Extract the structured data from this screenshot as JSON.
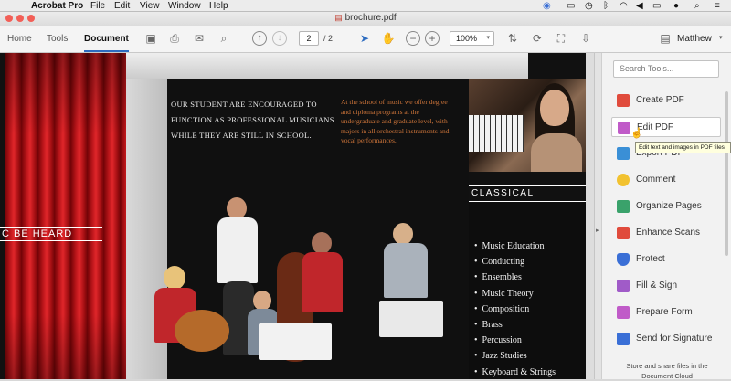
{
  "menubar": {
    "apple": "",
    "app": "Acrobat Pro",
    "items": [
      "File",
      "Edit",
      "View",
      "Window",
      "Help"
    ]
  },
  "window": {
    "title": "brochure.pdf"
  },
  "toolbar": {
    "tabs": [
      {
        "label": "Home",
        "active": false
      },
      {
        "label": "Tools",
        "active": false
      },
      {
        "label": "Document",
        "active": true
      }
    ],
    "page_current": "2",
    "page_total": "/ 2",
    "zoom": "100%",
    "user": "Matthew"
  },
  "document": {
    "side_heading": "C BE HEARD",
    "intro_text": "OUR STUDENT ARE ENCOURAGED TO FUNCTION AS PROFESSIONAL MUSICIANS WHILE THEY ARE STILL IN SCHOOL.",
    "orange_text": "At the school of music we offer degree and diploma programs at the undergraduate and graduate level, with majors in all orchestral instruments and vocal performances.",
    "classical_heading": "CLASSICAL TRAINING",
    "majors": [
      "Music Education",
      "Conducting",
      "Ensembles",
      "Music Theory",
      "Composition",
      "Brass",
      "Percussion",
      "Jazz Studies",
      "Keyboard & Strings"
    ]
  },
  "tools_panel": {
    "search_placeholder": "Search Tools...",
    "tools": [
      {
        "label": "Create PDF",
        "icon": "create-pdf-icon",
        "color": "#e04b3c"
      },
      {
        "label": "Edit PDF",
        "icon": "edit-pdf-icon",
        "color": "#c05bc8"
      },
      {
        "label": "Export PDF",
        "icon": "export-pdf-icon",
        "color": "#3a8fd6"
      },
      {
        "label": "Comment",
        "icon": "comment-icon",
        "color": "#f2c230"
      },
      {
        "label": "Organize Pages",
        "icon": "organize-pages-icon",
        "color": "#3aa26b"
      },
      {
        "label": "Enhance Scans",
        "icon": "enhance-scans-icon",
        "color": "#e04b3c"
      },
      {
        "label": "Protect",
        "icon": "protect-icon",
        "color": "#3a6fd6"
      },
      {
        "label": "Fill & Sign",
        "icon": "fill-sign-icon",
        "color": "#a05bc8"
      },
      {
        "label": "Prepare Form",
        "icon": "prepare-form-icon",
        "color": "#c05bc8"
      },
      {
        "label": "Send for Signature",
        "icon": "send-signature-icon",
        "color": "#3a6fd6"
      }
    ],
    "tooltip": "Edit text and images in PDF files",
    "store_text": "Store and share files in the Document Cloud"
  }
}
